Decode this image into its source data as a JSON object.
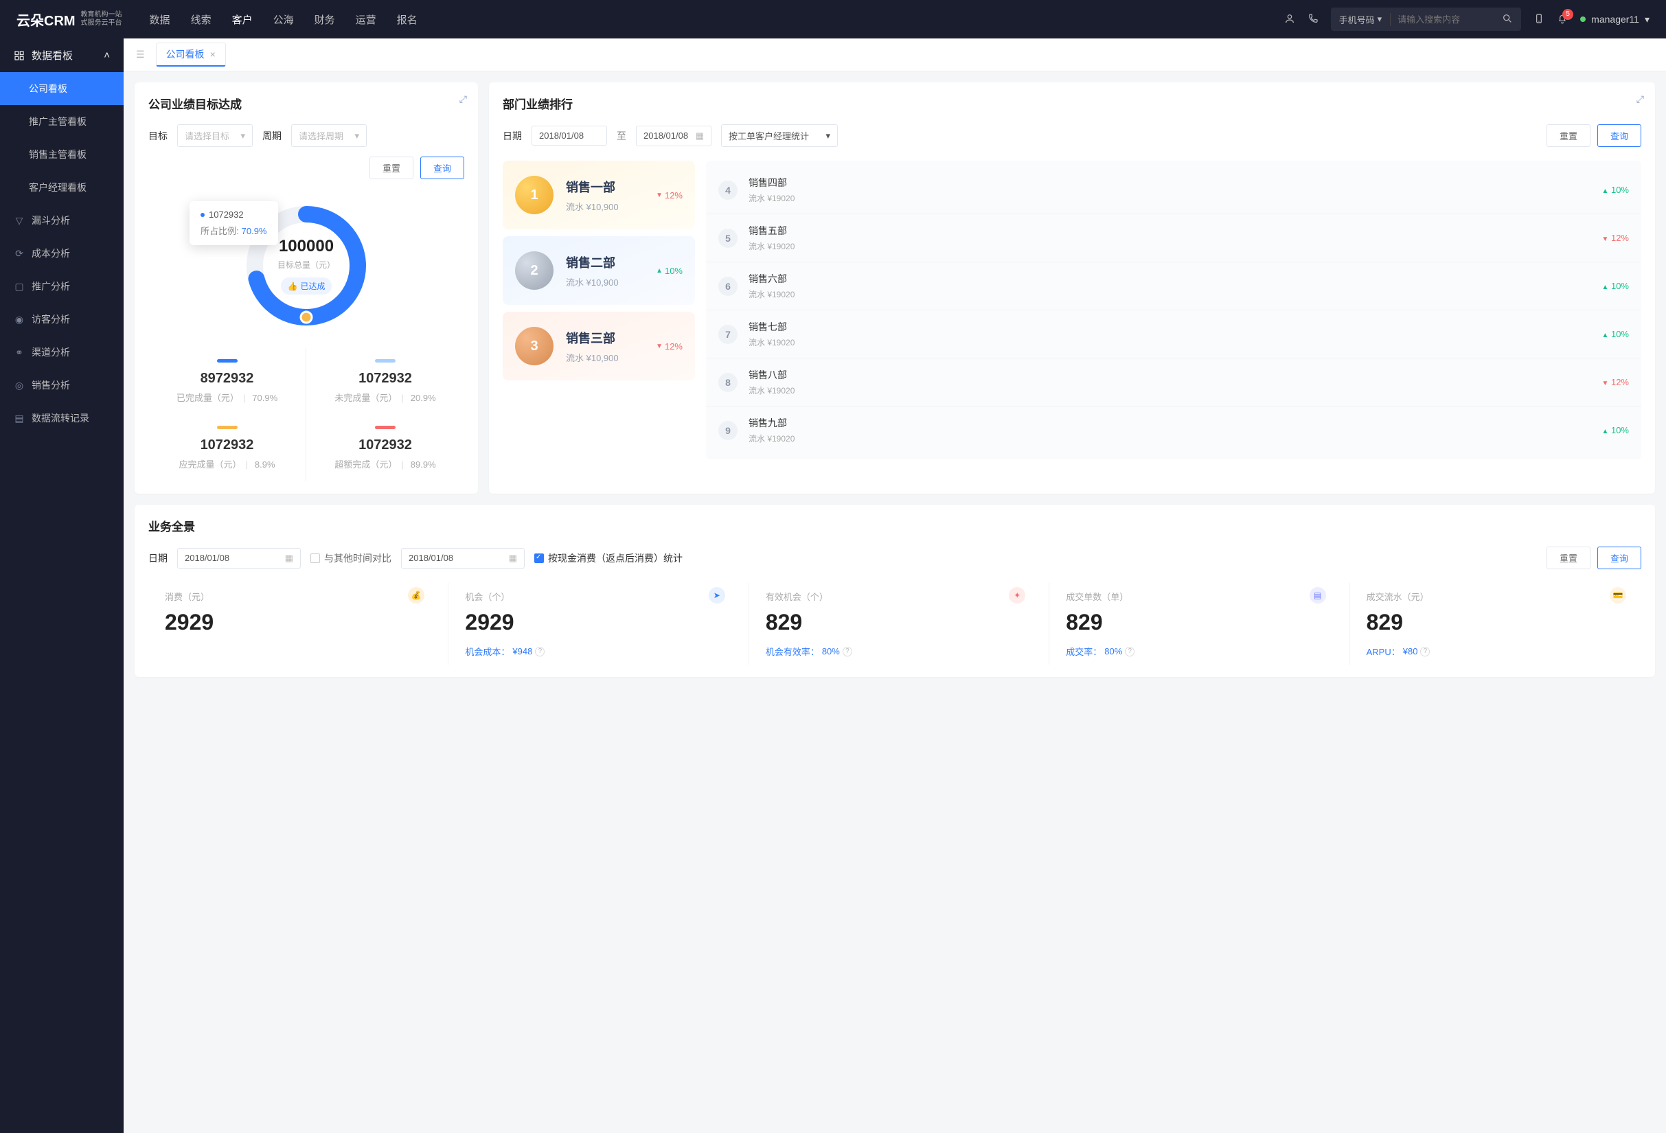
{
  "topnav": {
    "logo_main": "云朵CRM",
    "logo_sub1": "教育机构一站",
    "logo_sub2": "式服务云平台",
    "items": [
      "数据",
      "线索",
      "客户",
      "公海",
      "财务",
      "运营",
      "报名"
    ],
    "active": 2,
    "search_type": "手机号码",
    "search_placeholder": "请输入搜索内容",
    "badge": "5",
    "user": "manager11"
  },
  "sidebar": {
    "group_header": "数据看板",
    "group_items": [
      "公司看板",
      "推广主管看板",
      "销售主管看板",
      "客户经理看板"
    ],
    "group_active": 0,
    "singles": [
      "漏斗分析",
      "成本分析",
      "推广分析",
      "访客分析",
      "渠道分析",
      "销售分析",
      "数据流转记录"
    ]
  },
  "tab": {
    "label": "公司看板"
  },
  "card_goal": {
    "title": "公司业绩目标达成",
    "filter_target_label": "目标",
    "filter_target_placeholder": "请选择目标",
    "filter_period_label": "周期",
    "filter_period_placeholder": "请选择周期",
    "btn_reset": "重置",
    "btn_query": "查询",
    "tooltip_value": "1072932",
    "tooltip_ratio_label": "所占比例:",
    "tooltip_ratio_value": "70.9%",
    "donut_total": "100000",
    "donut_total_label": "目标总量（元）",
    "donut_badge": "已达成",
    "stats": [
      {
        "bar": "#2f7bff",
        "num": "8972932",
        "label": "已完成量（元）",
        "pct": "70.9%"
      },
      {
        "bar": "#a8d0ff",
        "num": "1072932",
        "label": "未完成量（元）",
        "pct": "20.9%"
      },
      {
        "bar": "#f7b84b",
        "num": "1072932",
        "label": "应完成量（元）",
        "pct": "8.9%"
      },
      {
        "bar": "#f56c6c",
        "num": "1072932",
        "label": "超额完成（元）",
        "pct": "89.9%"
      }
    ]
  },
  "card_rank": {
    "title": "部门业绩排行",
    "date_label": "日期",
    "date_from": "2018/01/08",
    "date_sep": "至",
    "date_to": "2018/01/08",
    "group_by": "按工单客户经理统计",
    "btn_reset": "重置",
    "btn_query": "查询",
    "top3": [
      {
        "pos": "1",
        "name": "销售一部",
        "sub": "流水 ¥10,900",
        "pct": "12%",
        "dir": "down",
        "cls": "gold"
      },
      {
        "pos": "2",
        "name": "销售二部",
        "sub": "流水 ¥10,900",
        "pct": "10%",
        "dir": "up",
        "cls": "silver"
      },
      {
        "pos": "3",
        "name": "销售三部",
        "sub": "流水 ¥10,900",
        "pct": "12%",
        "dir": "down",
        "cls": "bronze"
      }
    ],
    "rest": [
      {
        "pos": "4",
        "name": "销售四部",
        "sub": "流水 ¥19020",
        "pct": "10%",
        "dir": "up"
      },
      {
        "pos": "5",
        "name": "销售五部",
        "sub": "流水 ¥19020",
        "pct": "12%",
        "dir": "down"
      },
      {
        "pos": "6",
        "name": "销售六部",
        "sub": "流水 ¥19020",
        "pct": "10%",
        "dir": "up"
      },
      {
        "pos": "7",
        "name": "销售七部",
        "sub": "流水 ¥19020",
        "pct": "10%",
        "dir": "up"
      },
      {
        "pos": "8",
        "name": "销售八部",
        "sub": "流水 ¥19020",
        "pct": "12%",
        "dir": "down"
      },
      {
        "pos": "9",
        "name": "销售九部",
        "sub": "流水 ¥19020",
        "pct": "10%",
        "dir": "up"
      }
    ]
  },
  "card_pan": {
    "title": "业务全景",
    "date_label": "日期",
    "date1": "2018/01/08",
    "compare_label": "与其他时间对比",
    "date2": "2018/01/08",
    "stat_checkbox_label": "按现金消费（返点后消费）统计",
    "btn_reset": "重置",
    "btn_query": "查询",
    "cells": [
      {
        "label": "消费（元）",
        "num": "2929",
        "foot": "",
        "icon_bg": "#fff0d9",
        "icon_color": "#f0a92b",
        "icon": "💰"
      },
      {
        "label": "机会（个）",
        "num": "2929",
        "foot_label": "机会成本：",
        "foot_val": "¥948",
        "icon_bg": "#e8f1ff",
        "icon_color": "#2f7bff",
        "icon": "➤"
      },
      {
        "label": "有效机会（个）",
        "num": "829",
        "foot_label": "机会有效率：",
        "foot_val": "80%",
        "icon_bg": "#ffecea",
        "icon_color": "#f56c6c",
        "icon": "✦"
      },
      {
        "label": "成交单数（单）",
        "num": "829",
        "foot_label": "成交率：",
        "foot_val": "80%",
        "icon_bg": "#eceeff",
        "icon_color": "#6b7cff",
        "icon": "▤"
      },
      {
        "label": "成交流水（元）",
        "num": "829",
        "foot_label": "ARPU：",
        "foot_val": "¥80",
        "icon_bg": "#fff3e0",
        "icon_color": "#f0a92b",
        "icon": "💳"
      }
    ]
  },
  "chart_data": {
    "type": "pie",
    "title": "公司业绩目标达成",
    "total_label": "目标总量（元）",
    "total": 100000,
    "series": [
      {
        "name": "已完成量",
        "value": 8972932,
        "pct": 70.9,
        "color": "#2f7bff"
      },
      {
        "name": "未完成量",
        "value": 1072932,
        "pct": 20.9,
        "color": "#a8d0ff"
      },
      {
        "name": "应完成量",
        "value": 1072932,
        "pct": 8.9,
        "color": "#f7b84b"
      },
      {
        "name": "超额完成",
        "value": 1072932,
        "pct": 89.9,
        "color": "#f56c6c"
      }
    ]
  }
}
